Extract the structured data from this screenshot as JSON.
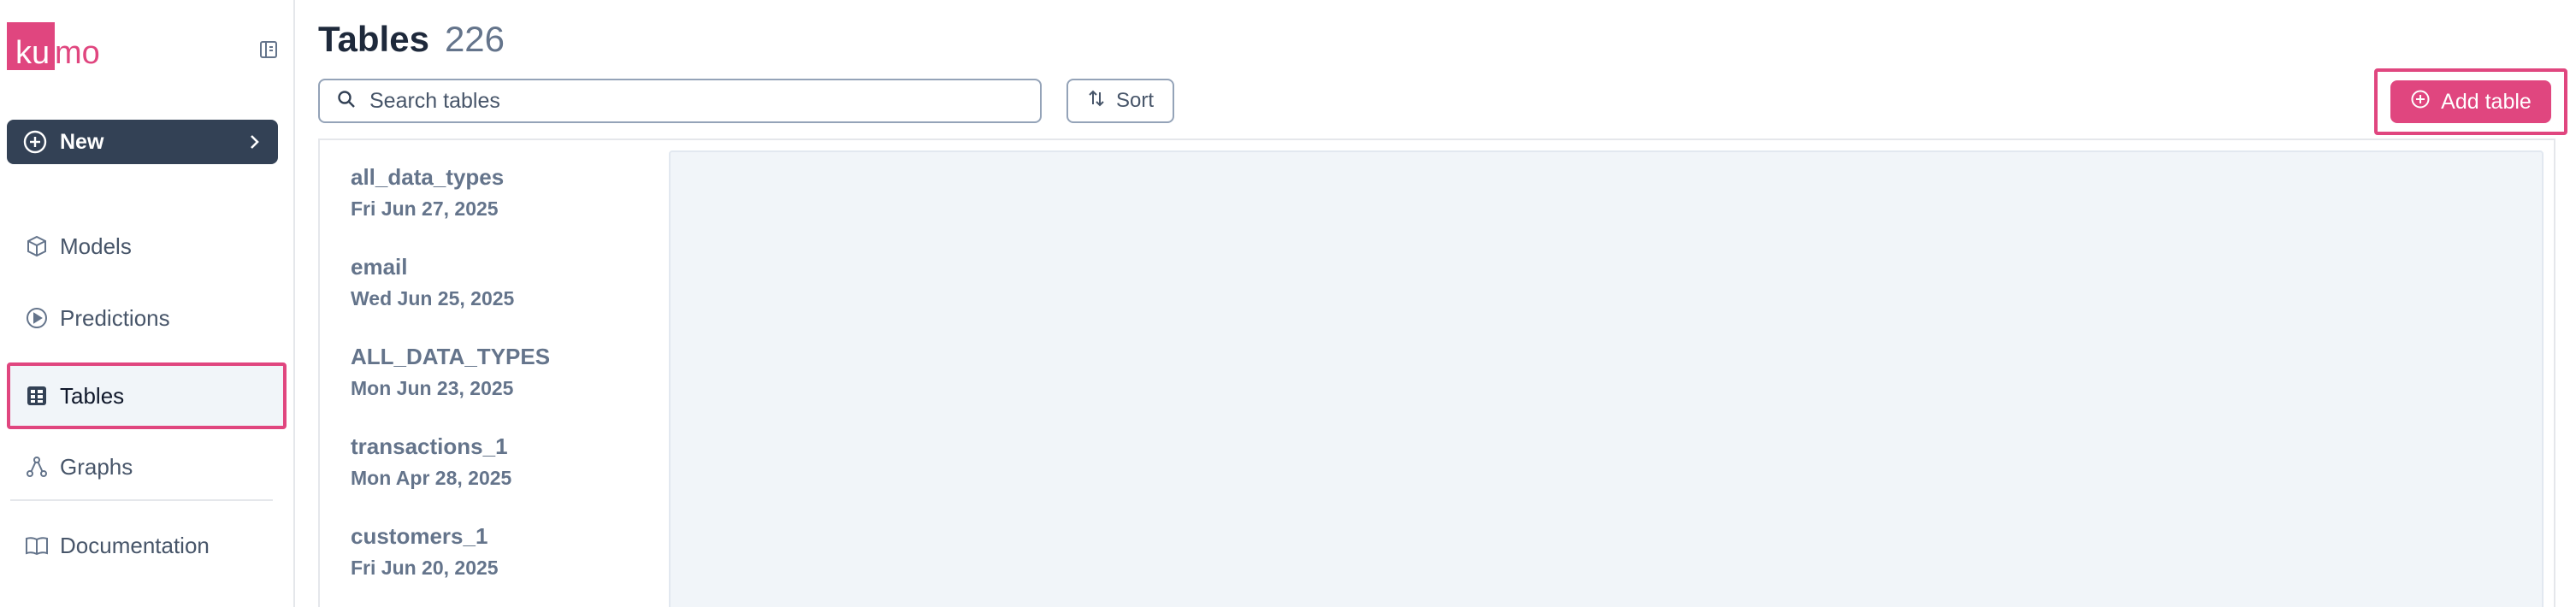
{
  "brand": {
    "logo_text": "kumo",
    "accent": "#e0467f"
  },
  "sidebar": {
    "new_button": {
      "label": "New",
      "icon": "plus-circle-icon",
      "trailing_icon": "chevron-right-icon"
    },
    "items": [
      {
        "label": "Models",
        "icon": "cube-icon",
        "active": false
      },
      {
        "label": "Predictions",
        "icon": "play-circle-icon",
        "active": false
      },
      {
        "label": "Tables",
        "icon": "table-grid-icon",
        "active": true
      },
      {
        "label": "Graphs",
        "icon": "graph-nodes-icon",
        "active": false
      },
      {
        "label": "Documentation",
        "icon": "book-icon",
        "active": false
      }
    ]
  },
  "main": {
    "title": "Tables",
    "count": "226",
    "search": {
      "placeholder": "Search tables",
      "value": ""
    },
    "sort_label": "Sort",
    "add_table_label": "Add table",
    "tables": [
      {
        "name": "all_data_types",
        "date": "Fri Jun 27, 2025"
      },
      {
        "name": "email",
        "date": "Wed Jun 25, 2025"
      },
      {
        "name": "ALL_DATA_TYPES",
        "date": "Mon Jun 23, 2025"
      },
      {
        "name": "transactions_1",
        "date": "Mon Apr 28, 2025"
      },
      {
        "name": "customers_1",
        "date": "Fri Jun 20, 2025"
      }
    ]
  }
}
